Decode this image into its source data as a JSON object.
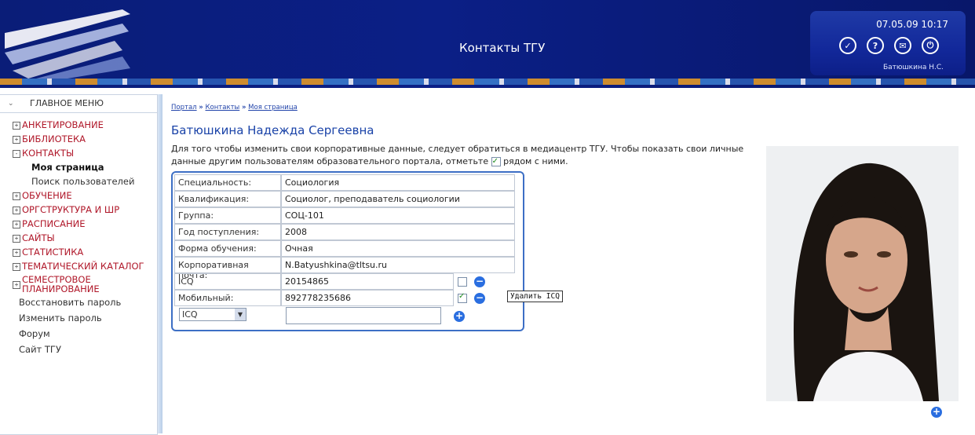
{
  "header": {
    "title": "Контакты ТГУ",
    "datetime": "07.05.09 10:17",
    "user_name": "Батюшкина Н.С.",
    "icons": [
      "check-icon",
      "help-icon",
      "mail-icon",
      "logout-icon"
    ]
  },
  "sidebar": {
    "title": "ГЛАВНОЕ МЕНЮ",
    "items": [
      {
        "label": "АНКЕТИРОВАНИЕ",
        "state": "+"
      },
      {
        "label": "БИБЛИОТЕКА",
        "state": "+"
      },
      {
        "label": "КОНТАКТЫ",
        "state": "-"
      },
      {
        "label": "ОБУЧЕНИЕ",
        "state": "+"
      },
      {
        "label": "ОРГСТРУКТУРА И ШР",
        "state": "+"
      },
      {
        "label": "РАСПИСАНИЕ",
        "state": "+"
      },
      {
        "label": "САЙТЫ",
        "state": "+"
      },
      {
        "label": "СТАТИСТИКА",
        "state": "+"
      },
      {
        "label": "ТЕМАТИЧЕСКИЙ КАТАЛОГ",
        "state": "+"
      },
      {
        "label": "СЕМЕСТРОВОЕ ПЛАНИРОВАНИЕ",
        "state": "+"
      }
    ],
    "contacts_sub": [
      "Моя страница",
      "Поиск пользователей"
    ],
    "links": [
      "Восстановить пароль",
      "Изменить пароль",
      "Форум",
      "Сайт ТГУ"
    ]
  },
  "breadcrumb": [
    "Портал",
    "Контакты",
    "Моя страница"
  ],
  "breadcrumb_sep": "»",
  "page": {
    "title": "Батюшкина Надежда Сергеевна",
    "intro_1": "Для того чтобы изменить свои корпоративные данные, следует обратиться в медиацентр ТГУ. Чтобы показать свои личные",
    "intro_2": "данные другим пользователям образовательного портала, отметьте",
    "intro_3": "рядом с ними."
  },
  "table": {
    "rows": [
      {
        "key": "Специальность:",
        "value": "Социология"
      },
      {
        "key": "Квалификация:",
        "value": "Социолог, преподаватель социологии"
      },
      {
        "key": "Группа:",
        "value": "СОЦ-101"
      },
      {
        "key": "Год поступления:",
        "value": "2008"
      },
      {
        "key": "Форма обучения:",
        "value": "Очная"
      },
      {
        "key": "Корпоративная почта:",
        "value": "N.Batyushkina@tltsu.ru"
      }
    ],
    "personal": [
      {
        "key": "ICQ",
        "value": "20154865",
        "visible": false
      },
      {
        "key": "Мобильный:",
        "value": "892778235686",
        "visible": true
      }
    ],
    "new_type": "ICQ",
    "new_value": ""
  },
  "tooltip": "Удалить ICQ",
  "colors": {
    "header_bg": "#0b1f86",
    "menu_red": "#b0182a",
    "title_blue": "#1a43a8",
    "action_blue": "#2a6ee0"
  }
}
